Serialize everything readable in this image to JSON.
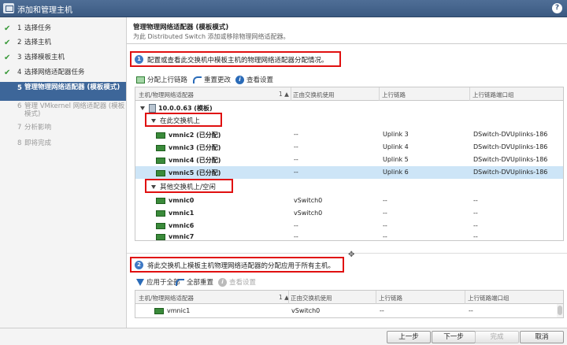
{
  "window": {
    "title": "添加和管理主机",
    "help": "?"
  },
  "steps": [
    {
      "num": "1",
      "label": "选择任务",
      "state": "done"
    },
    {
      "num": "2",
      "label": "选择主机",
      "state": "done"
    },
    {
      "num": "3",
      "label": "选择模板主机",
      "state": "done"
    },
    {
      "num": "4",
      "label": "选择网络适配器任务",
      "state": "done"
    },
    {
      "num": "5",
      "label": "管理物理网络适配器 (模板模式)",
      "state": "active"
    },
    {
      "num": "6",
      "label": "管理 VMkernel 网络适配器 (模板模式)",
      "state": "pending"
    },
    {
      "num": "7",
      "label": "分析影响",
      "state": "pending"
    },
    {
      "num": "8",
      "label": "即将完成",
      "state": "pending"
    }
  ],
  "page": {
    "heading": "管理物理网络适配器 (模板模式)",
    "subheading": "为此 Distributed Switch 添加或移除物理网络适配器。"
  },
  "note1": {
    "num": "1",
    "text": "配置或查看此交换机中模板主机的物理网络适配器分配情况。"
  },
  "toolbar1": {
    "assign": "分配上行链路",
    "reset": "重置更改",
    "view": "查看设置"
  },
  "grid1": {
    "headers": [
      "主机/物理网络适配器",
      "1 ▲",
      "正由交换机使用",
      "上行链路",
      "上行链路端口组"
    ],
    "host": "10.0.0.63 (模板)",
    "group_on_switch": "在此交换机上",
    "group_other": "其他交换机上/空闲",
    "on_switch_rows": [
      {
        "name": "vmnic2 (已分配)",
        "in_use": "--",
        "uplink": "Uplink 3",
        "portgroup": "DSwitch-DVUplinks-186"
      },
      {
        "name": "vmnic3 (已分配)",
        "in_use": "--",
        "uplink": "Uplink 4",
        "portgroup": "DSwitch-DVUplinks-186"
      },
      {
        "name": "vmnic4 (已分配)",
        "in_use": "--",
        "uplink": "Uplink 5",
        "portgroup": "DSwitch-DVUplinks-186"
      },
      {
        "name": "vmnic5 (已分配)",
        "in_use": "--",
        "uplink": "Uplink 6",
        "portgroup": "DSwitch-DVUplinks-186"
      }
    ],
    "other_rows": [
      {
        "name": "vmnic0",
        "in_use": "vSwitch0",
        "uplink": "--",
        "portgroup": "--"
      },
      {
        "name": "vmnic1",
        "in_use": "vSwitch0",
        "uplink": "--",
        "portgroup": "--"
      },
      {
        "name": "vmnic6",
        "in_use": "--",
        "uplink": "--",
        "portgroup": "--"
      },
      {
        "name": "vmnic7",
        "in_use": "--",
        "uplink": "--",
        "portgroup": "--"
      }
    ]
  },
  "note2": {
    "num": "2",
    "text": "将此交换机上模板主机物理网络适配器的分配应用于所有主机。"
  },
  "toolbar2": {
    "apply": "应用于全部",
    "reset": "全部重置",
    "view": "查看设置"
  },
  "grid2": {
    "headers": [
      "主机/物理网络适配器",
      "1 ▲",
      "正由交换机使用",
      "上行链路",
      "上行链路端口组"
    ],
    "rows": [
      {
        "name": "vmnic1",
        "in_use": "vSwitch0",
        "uplink": "--",
        "portgroup": "--"
      }
    ]
  },
  "footer": {
    "back": "上一步",
    "next": "下一步",
    "finish": "完成",
    "cancel": "取消"
  }
}
